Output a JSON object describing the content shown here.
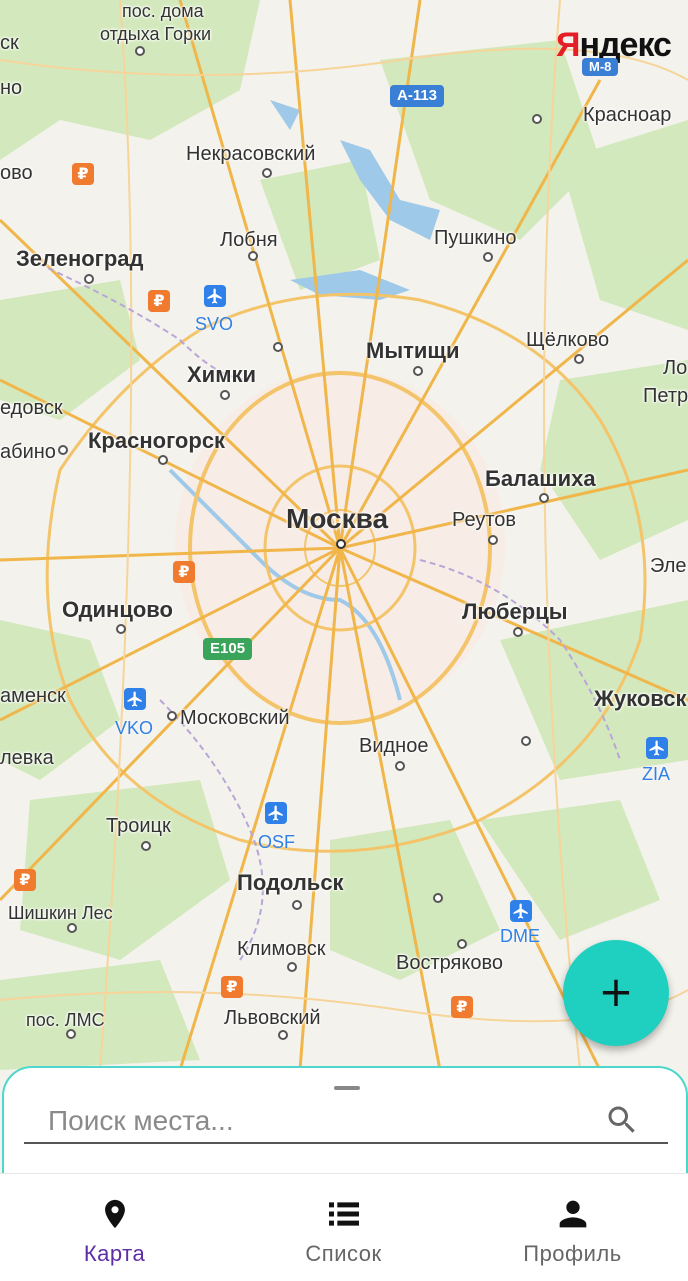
{
  "map": {
    "logo": "Яндекс",
    "places": [
      {
        "name": "пос. дома",
        "cls": "sm"
      },
      {
        "name": "отдыха Горки",
        "cls": "sm"
      },
      {
        "name": "Некрасовский"
      },
      {
        "name": "Красноар"
      },
      {
        "name": "Лобня"
      },
      {
        "name": "Пушкино"
      },
      {
        "name": "Зеленоград",
        "cls": "b"
      },
      {
        "name": "Мытищи",
        "cls": "b"
      },
      {
        "name": "Щёлково"
      },
      {
        "name": "Химки",
        "cls": "b"
      },
      {
        "name": "Красногорск",
        "cls": "b"
      },
      {
        "name": "Балашиха",
        "cls": "b"
      },
      {
        "name": "Москва",
        "cls": "big"
      },
      {
        "name": "Реутов"
      },
      {
        "name": "Одинцово",
        "cls": "b"
      },
      {
        "name": "Люберцы",
        "cls": "b"
      },
      {
        "name": "Московский"
      },
      {
        "name": "Жуковск",
        "cls": "b"
      },
      {
        "name": "Видное"
      },
      {
        "name": "Троицк"
      },
      {
        "name": "Подольск",
        "cls": "b"
      },
      {
        "name": "Шишкин Лес",
        "cls": "sm"
      },
      {
        "name": "Климовск"
      },
      {
        "name": "Востряково"
      },
      {
        "name": "пос. ЛМС",
        "cls": "sm"
      },
      {
        "name": "Львовский"
      },
      {
        "name": "ск"
      },
      {
        "name": "но"
      },
      {
        "name": "ово"
      },
      {
        "name": "едовск"
      },
      {
        "name": "абино"
      },
      {
        "name": "аменск"
      },
      {
        "name": "левка"
      },
      {
        "name": "Ло"
      },
      {
        "name": "Петр"
      },
      {
        "name": "Эле"
      }
    ],
    "airports": [
      "SVO",
      "VKO",
      "OSF",
      "DME",
      "ZIA"
    ],
    "roads": [
      "A-113",
      "M-8",
      "E105"
    ]
  },
  "fab": {
    "label": "+"
  },
  "search": {
    "placeholder": "Поиск места..."
  },
  "nav": [
    {
      "label": "Карта",
      "icon": "map-pin-icon",
      "active": true
    },
    {
      "label": "Список",
      "icon": "list-icon",
      "active": false
    },
    {
      "label": "Профиль",
      "icon": "person-icon",
      "active": false
    }
  ],
  "colors": {
    "accent": "#1fd0c0",
    "active_nav": "#5d2ea5",
    "sheet_border": "#4dd7cc"
  }
}
